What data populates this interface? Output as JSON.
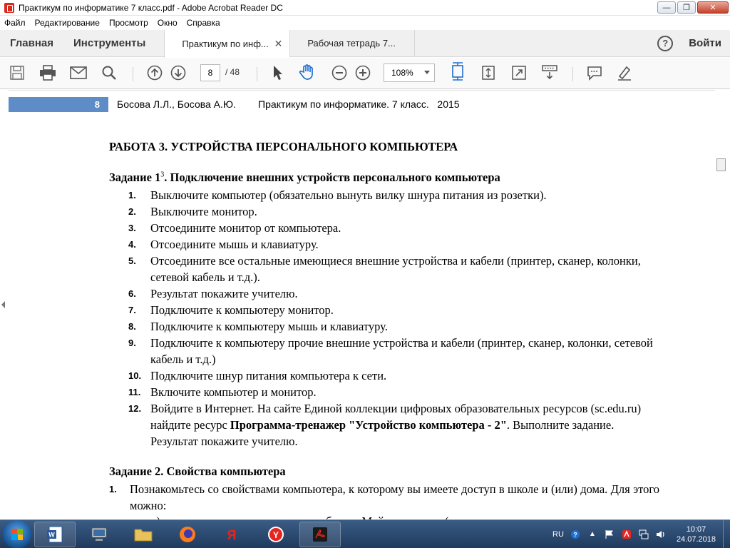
{
  "window": {
    "title": "Практикум по информатике 7 класс.pdf - Adobe Acrobat Reader DC",
    "controls": {
      "minimize": "—",
      "maximize": "❐",
      "close": "✕"
    }
  },
  "menu": [
    "Файл",
    "Редактирование",
    "Просмотр",
    "Окно",
    "Справка"
  ],
  "tabs": {
    "home": "Главная",
    "tools": "Инструменты",
    "doc1": "Практикум по инф...",
    "doc2": "Рабочая тетрадь 7...",
    "help": "?",
    "signin": "Войти"
  },
  "toolbar": {
    "page_current": "8",
    "page_total": "/ 48",
    "zoom": "108%"
  },
  "page": {
    "number": "8",
    "header": "Босова Л.Л., Босова А.Ю.        Практикум по информатике. 7 класс.   2015",
    "title": "РАБОТА 3.  УСТРОЙСТВА ПЕРСОНАЛЬНОГО КОМПЬЮТЕРА",
    "task1": {
      "prefix": "Задание 1",
      "sup": "3",
      "suffix": ". Подключение внешних устройств персонального компьютера",
      "items": [
        {
          "num": "1.",
          "text": "Выключите компьютер (обязательно вынуть вилку шнура питания из розетки)."
        },
        {
          "num": "2.",
          "text": "Выключите монитор."
        },
        {
          "num": "3.",
          "text": "Отсоедините монитор от компьютера."
        },
        {
          "num": "4.",
          "text": "Отсоедините мышь и клавиатуру."
        },
        {
          "num": "5.",
          "text": "Отсоедините все остальные имеющиеся внешние устройства и кабели (принтер, сканер, колонки, сетевой кабель и т.д.)."
        },
        {
          "num": "6.",
          "text": "Результат покажите учителю."
        },
        {
          "num": "7.",
          "text": "Подключите к компьютеру монитор."
        },
        {
          "num": "8.",
          "text": "Подключите к компьютеру мышь и клавиатуру."
        },
        {
          "num": "9.",
          "text": "Подключите к компьютеру прочие внешние устройства и кабели (принтер, сканер, колонки, сетевой кабель и т.д.)"
        },
        {
          "num": "10.",
          "text": "Подключите шнур питания компьютера к сети."
        },
        {
          "num": "11.",
          "text": "Включите компьютер и монитор."
        }
      ],
      "item12": {
        "num": "12.",
        "text_a": "Войдите в Интернет. На сайте Единой коллекции цифровых образовательных ресурсов (sc.edu.ru) найдите ресурс ",
        "text_b": "Программа-тренажер \"Устройство компьютера - 2\"",
        "text_c": ". Выполните задание. Результат покажите учителю."
      }
    },
    "task2": {
      "heading": "Задание 2. Свойства компьютера",
      "item1_num": "1.",
      "item1_text": "Познакомьтесь со свойствами компьютера, к которому вы имеете доступ в школе и (или) дома. Для этого можно:",
      "clipped": "а)  вызвать контекстное меню для объекта Мой компьютер (установить указатель мыши"
    }
  },
  "taskbar": {
    "apps": [
      "windows-explorer-icon",
      "word-icon",
      "computer-icon",
      "folder-icon",
      "firefox-icon",
      "yandex-icon",
      "yandex-browser-icon",
      "acrobat-icon"
    ],
    "tray": {
      "lang": "RU",
      "time": "10:07",
      "date": "24.07.2018"
    }
  },
  "colors": {
    "page_header_blue": "#5d8cc7",
    "acrobat_red": "#d9281c",
    "taskbar": "#1f3a5e"
  }
}
